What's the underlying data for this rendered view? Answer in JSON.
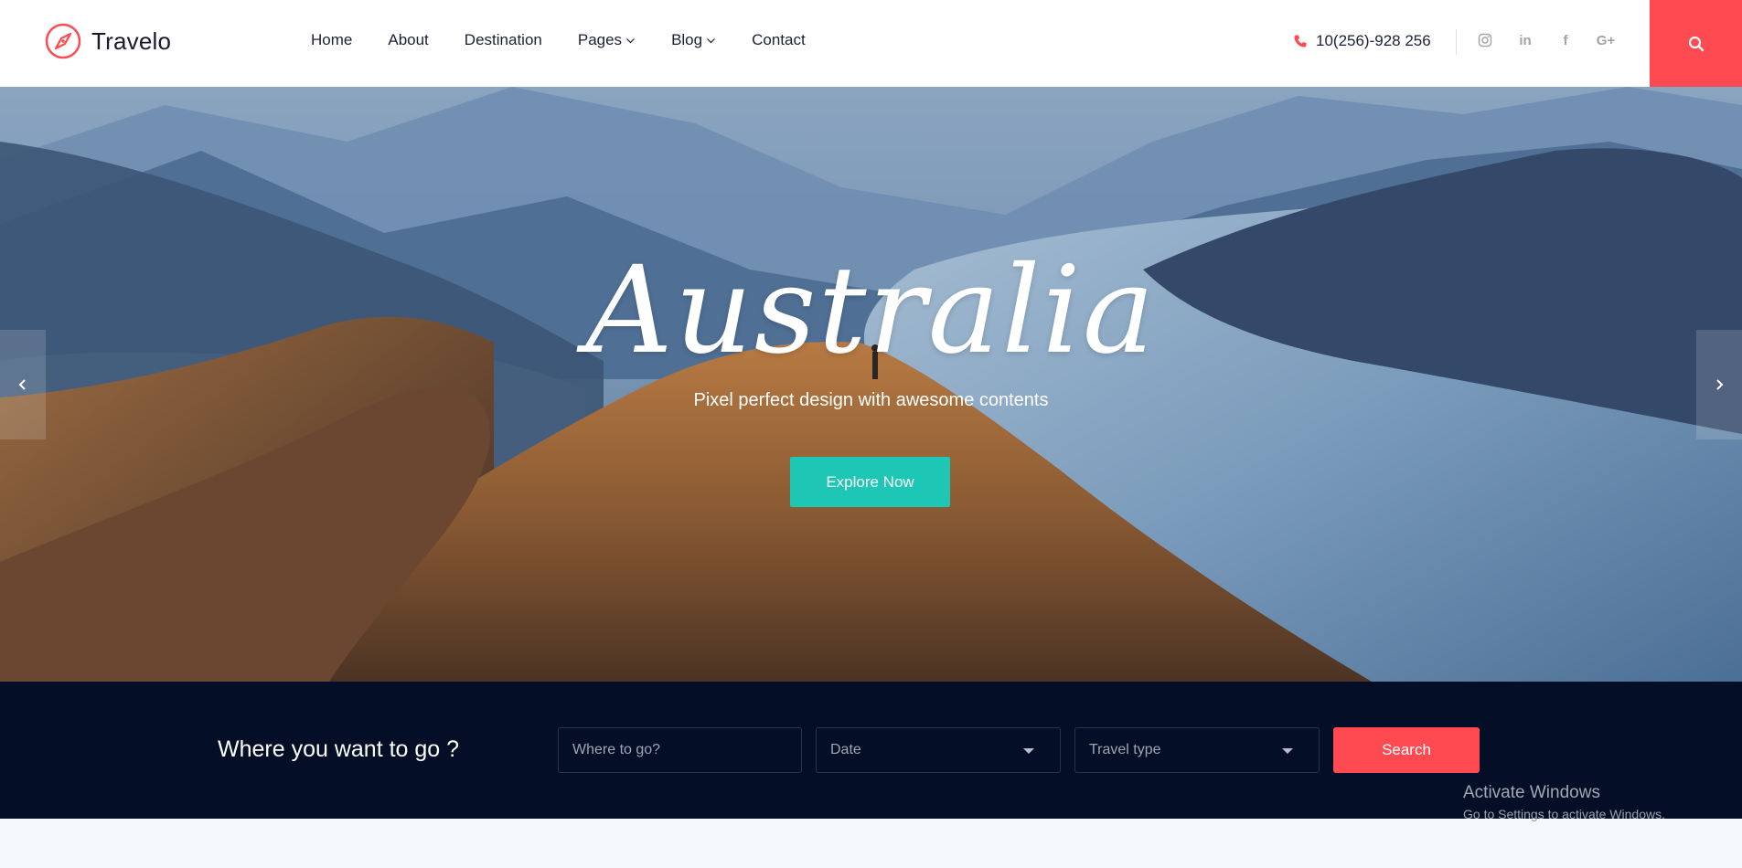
{
  "header": {
    "logo_text": "Travelo",
    "nav": [
      {
        "label": "Home"
      },
      {
        "label": "About"
      },
      {
        "label": "Destination"
      },
      {
        "label": "Pages"
      },
      {
        "label": "Blog"
      },
      {
        "label": "Contact"
      }
    ],
    "phone": "10(256)-928 256",
    "social_icons": [
      "instagram-icon",
      "linkedin-icon",
      "facebook-icon",
      "google-plus-icon"
    ],
    "google_plus_text": "G+",
    "linkedin_text": "in",
    "facebook_text": "f"
  },
  "hero": {
    "title": "Australia",
    "subtitle": "Pixel perfect design with awesome contents",
    "button_label": "Explore Now"
  },
  "search": {
    "label": "Where you want to go ?",
    "where_placeholder": "Where to go?",
    "date_value": "Date",
    "travel_type_value": "Travel type",
    "search_label": "Search"
  },
  "watermark": {
    "title": "Activate Windows",
    "subtitle": "Go to Settings to activate Windows."
  },
  "colors": {
    "accent": "#ff4a52",
    "teal": "#1ec6b6",
    "navy": "#040e27"
  }
}
